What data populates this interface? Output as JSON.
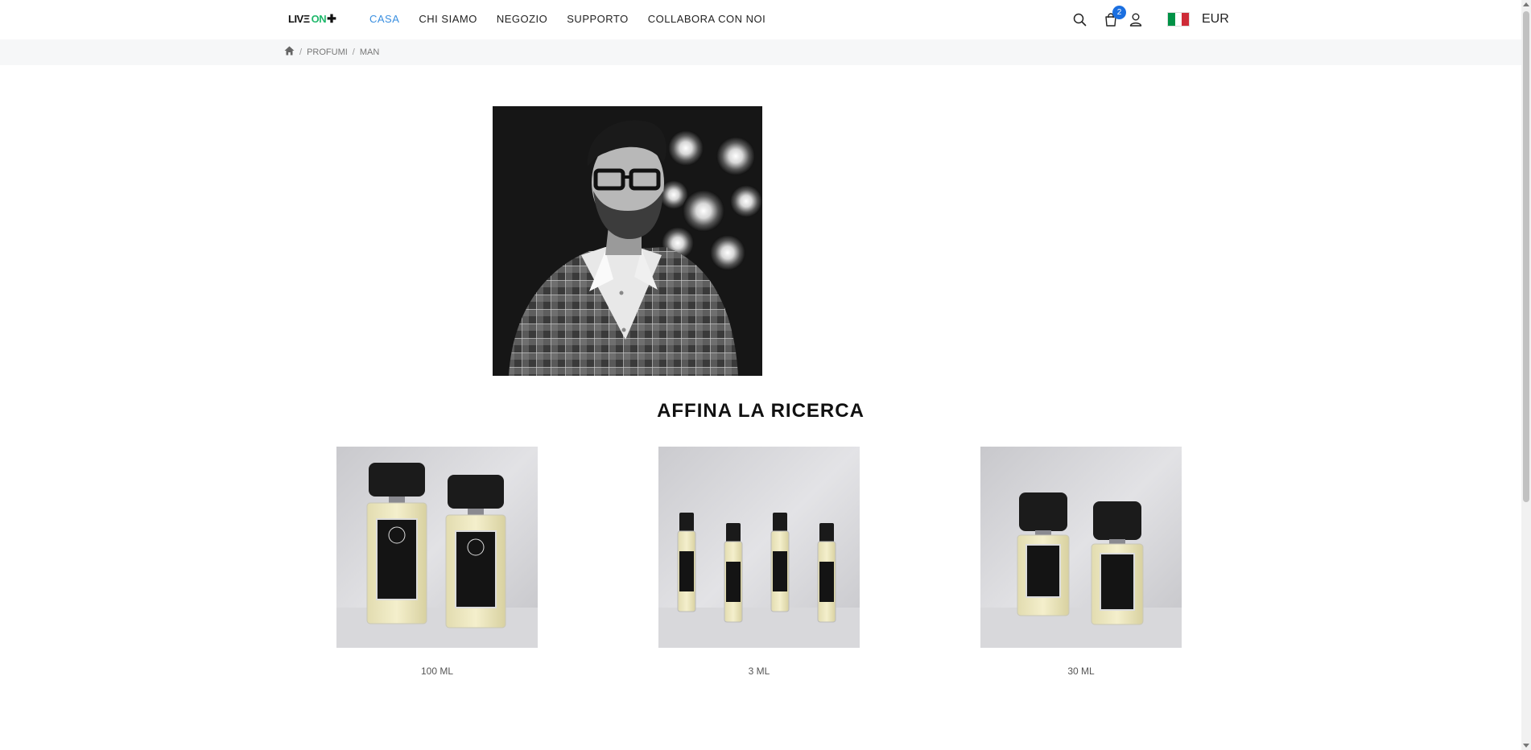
{
  "header": {
    "logo": {
      "part1": "LIVΞ",
      "part2": "ON",
      "part3": "✚"
    },
    "nav": [
      {
        "label": "CASA",
        "active": true
      },
      {
        "label": "CHI SIAMO",
        "active": false
      },
      {
        "label": "NEGOZIO",
        "active": false
      },
      {
        "label": "SUPPORTO",
        "active": false
      },
      {
        "label": "COLLABORA CON NOI",
        "active": false
      }
    ],
    "cart_count": "2",
    "currency": "EUR",
    "icons": {
      "search": "search-icon",
      "cart": "shopping-bag-icon",
      "user": "user-icon",
      "flag": "italy-flag-icon"
    }
  },
  "breadcrumb": {
    "items": [
      "PROFUMI",
      "MAN"
    ],
    "separator": "/"
  },
  "main": {
    "section_title": "AFFINA LA RICERCA",
    "products": [
      {
        "label": "100 ML"
      },
      {
        "label": "3 ML"
      },
      {
        "label": "30 ML"
      }
    ]
  },
  "colors": {
    "accent": "#3a8fe0",
    "badge": "#1b6fe0",
    "logo_green": "#1fb86b"
  }
}
